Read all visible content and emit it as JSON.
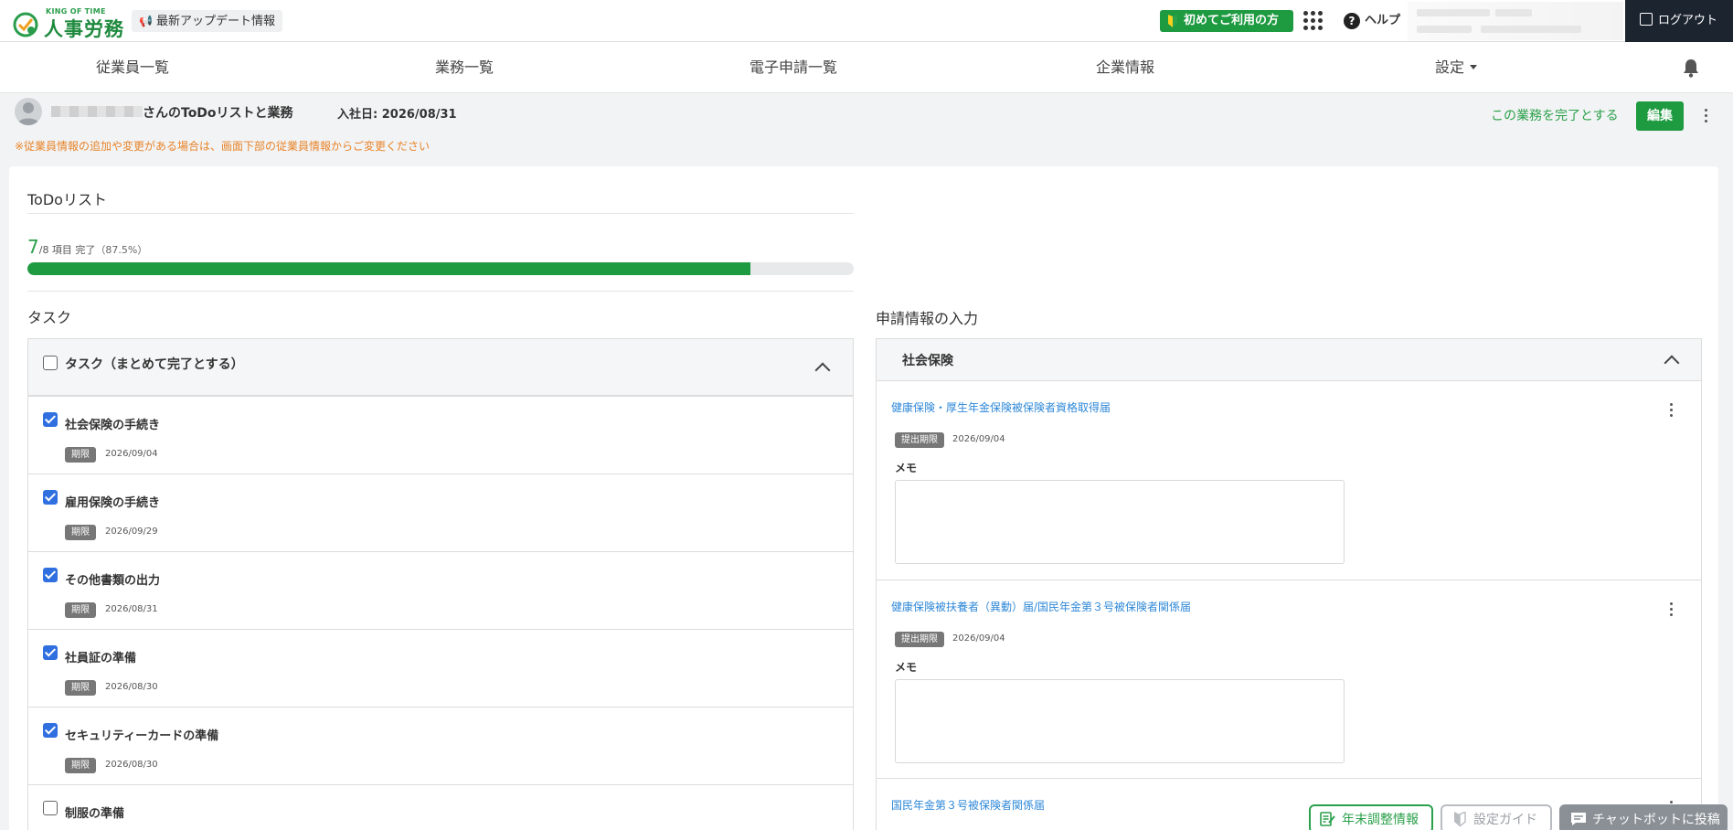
{
  "header": {
    "logo_small": "KING OF TIME",
    "logo_name": "人事労務",
    "update_label": "最新アップデート情報",
    "first_use_label": "初めてご利用の方",
    "help_label": "ヘルプ",
    "logout_label": "ログアウト"
  },
  "nav": {
    "items": [
      "従業員一覧",
      "業務一覧",
      "電子申請一覧",
      "企業情報",
      "設定"
    ]
  },
  "page": {
    "title_suffix": "さんのToDoリストと業務",
    "hire_date": "入社日: 2026/08/31",
    "notice": "※従業員情報の追加や変更がある場合は、画面下部の従業員情報からご変更ください",
    "complete_link": "この業務を完了とする",
    "edit_label": "編集"
  },
  "todo": {
    "title": "ToDoリスト",
    "done_count": "7",
    "total_label": "/8 項目 完了",
    "percent_label": "（87.5%）",
    "progress": 0.875
  },
  "tasks": {
    "section_title": "タスク",
    "select_all_label": "タスク（まとめて完了とする）",
    "deadline_label": "期限",
    "items": [
      {
        "label": "社会保険の手続き",
        "date": "2026/09/04",
        "checked": true
      },
      {
        "label": "雇用保険の手続き",
        "date": "2026/09/29",
        "checked": true
      },
      {
        "label": "その他書類の出力",
        "date": "2026/08/31",
        "checked": true
      },
      {
        "label": "社員証の準備",
        "date": "2026/08/30",
        "checked": true
      },
      {
        "label": "セキュリティーカードの準備",
        "date": "2026/08/30",
        "checked": true
      },
      {
        "label": "制服の準備",
        "date": "",
        "checked": false
      }
    ]
  },
  "applications": {
    "section_title": "申請情報の入力",
    "group_title": "社会保険",
    "deadline_label": "提出期限",
    "memo_label": "メモ",
    "items": [
      {
        "title": "健康保険・厚生年金保険被保険者資格取得届",
        "date": "2026/09/04"
      },
      {
        "title": "健康保険被扶養者（異動）届/国民年金第３号被保険者関係届",
        "date": "2026/09/04"
      },
      {
        "title": "国民年金第３号被保険者関係届",
        "date": ""
      }
    ]
  },
  "floating": {
    "year_end": "年末調整情報",
    "setup_guide": "設定ガイド",
    "chatbot": "チャットボットに投稿"
  },
  "colors": {
    "brand_green": "#1e9a40",
    "link_blue": "#2f88d8",
    "notice_orange": "#e8842a",
    "logout_bg": "#1c2430"
  }
}
